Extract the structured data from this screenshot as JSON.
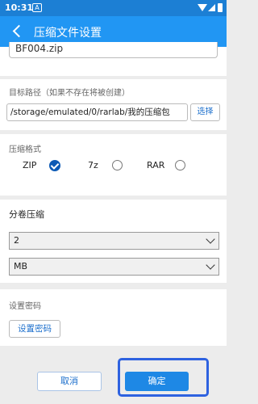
{
  "status_bar": {
    "time": "10:31",
    "notification_badge": "A"
  },
  "app_bar": {
    "title": "压缩文件设置"
  },
  "filename": {
    "value": "BF004.zip"
  },
  "target_path": {
    "label": "目标路径（如果不存在将被创建）",
    "value": "/storage/emulated/0/rarlab/我的压缩包",
    "choose_label": "选择"
  },
  "format": {
    "label": "压缩格式",
    "options": [
      {
        "label": "ZIP",
        "selected": true
      },
      {
        "label": "7z",
        "selected": false
      },
      {
        "label": "RAR",
        "selected": false
      }
    ]
  },
  "split": {
    "label": "分卷压缩",
    "size_value": "2",
    "unit_value": "MB"
  },
  "password": {
    "label": "设置密码",
    "button_label": "设置密码"
  },
  "actions": {
    "cancel_label": "取消",
    "confirm_label": "确定"
  }
}
